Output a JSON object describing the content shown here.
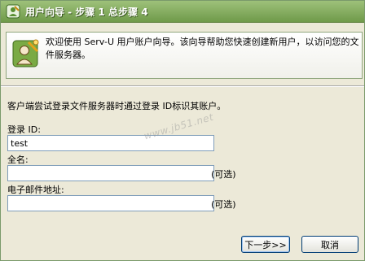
{
  "window": {
    "title": "用户向导 - 步骤 1 总步骤 4",
    "icon": "wizard-icon"
  },
  "banner": {
    "text": "欢迎使用 Serv-U 用户账户向导。该向导帮助您快速创建新用户，以访问您的文件服务器。",
    "icon": "user-wizard-icon"
  },
  "form": {
    "intro": "客户端尝试登录文件服务器时通过登录 ID标识其账户。",
    "login_id_label": "登录 ID:",
    "login_id_value": "test",
    "fullname_label": "全名:",
    "fullname_value": "",
    "fullname_optional": "(可选)",
    "email_label": "电子邮件地址:",
    "email_value": "",
    "email_optional": "(可选)"
  },
  "buttons": {
    "next_label": "下一步>>",
    "cancel_label": "取消"
  },
  "watermark": "www.jb51.net",
  "colors": {
    "titlebar": "#7ea85a",
    "window_bg": "#ece9d8",
    "input_border": "#7f9db9"
  }
}
